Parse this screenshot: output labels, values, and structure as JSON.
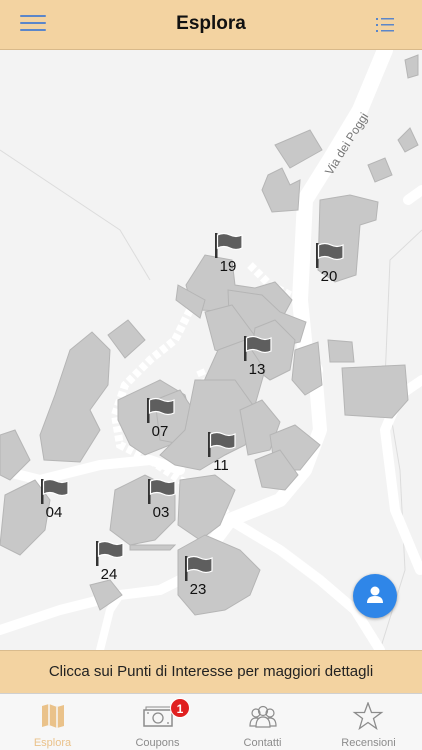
{
  "header": {
    "title": "Esplora",
    "menu_icon": "hamburger-icon",
    "list_icon": "list-icon",
    "background": "#f3d3a1",
    "icon_color": "#5b86c9"
  },
  "map": {
    "road_label": "Via dei Poggi",
    "markers": [
      {
        "id": "19"
      },
      {
        "id": "20"
      },
      {
        "id": "13"
      },
      {
        "id": "07"
      },
      {
        "id": "11"
      },
      {
        "id": "04"
      },
      {
        "id": "03"
      },
      {
        "id": "24"
      },
      {
        "id": "23"
      }
    ],
    "locate_button_color": "#2f86e8"
  },
  "hint": {
    "text": "Clicca sui Punti di Interesse per maggiori dettagli"
  },
  "tabbar": {
    "tabs": [
      {
        "label": "Esplora",
        "icon": "map-icon",
        "active": true
      },
      {
        "label": "Coupons",
        "icon": "money-icon",
        "badge": "1"
      },
      {
        "label": "Contatti",
        "icon": "contacts-icon"
      },
      {
        "label": "Recensioni",
        "icon": "star-icon"
      }
    ],
    "active_color": "#eac28a",
    "badge_color": "#e02020"
  }
}
